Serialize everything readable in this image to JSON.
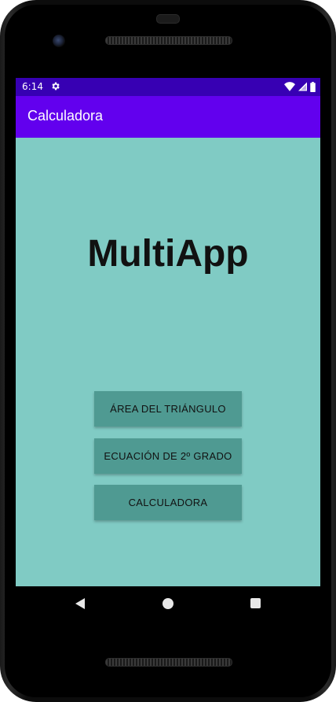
{
  "status": {
    "time": "6:14",
    "icons": [
      "gear-icon",
      "wifi-icon",
      "signal-icon",
      "battery-icon"
    ]
  },
  "appbar": {
    "title": "Calculadora",
    "color": "#6200ee"
  },
  "main": {
    "heading": "MultiApp",
    "background": "#80cbc4",
    "buttons": [
      {
        "label": "ÁREA DEL TRIÁNGULO"
      },
      {
        "label": "ECUACIÓN DE 2º GRADO"
      },
      {
        "label": "CALCULADORA"
      }
    ]
  },
  "navbar": {
    "icons": [
      "back-icon",
      "home-icon",
      "recents-icon"
    ]
  }
}
